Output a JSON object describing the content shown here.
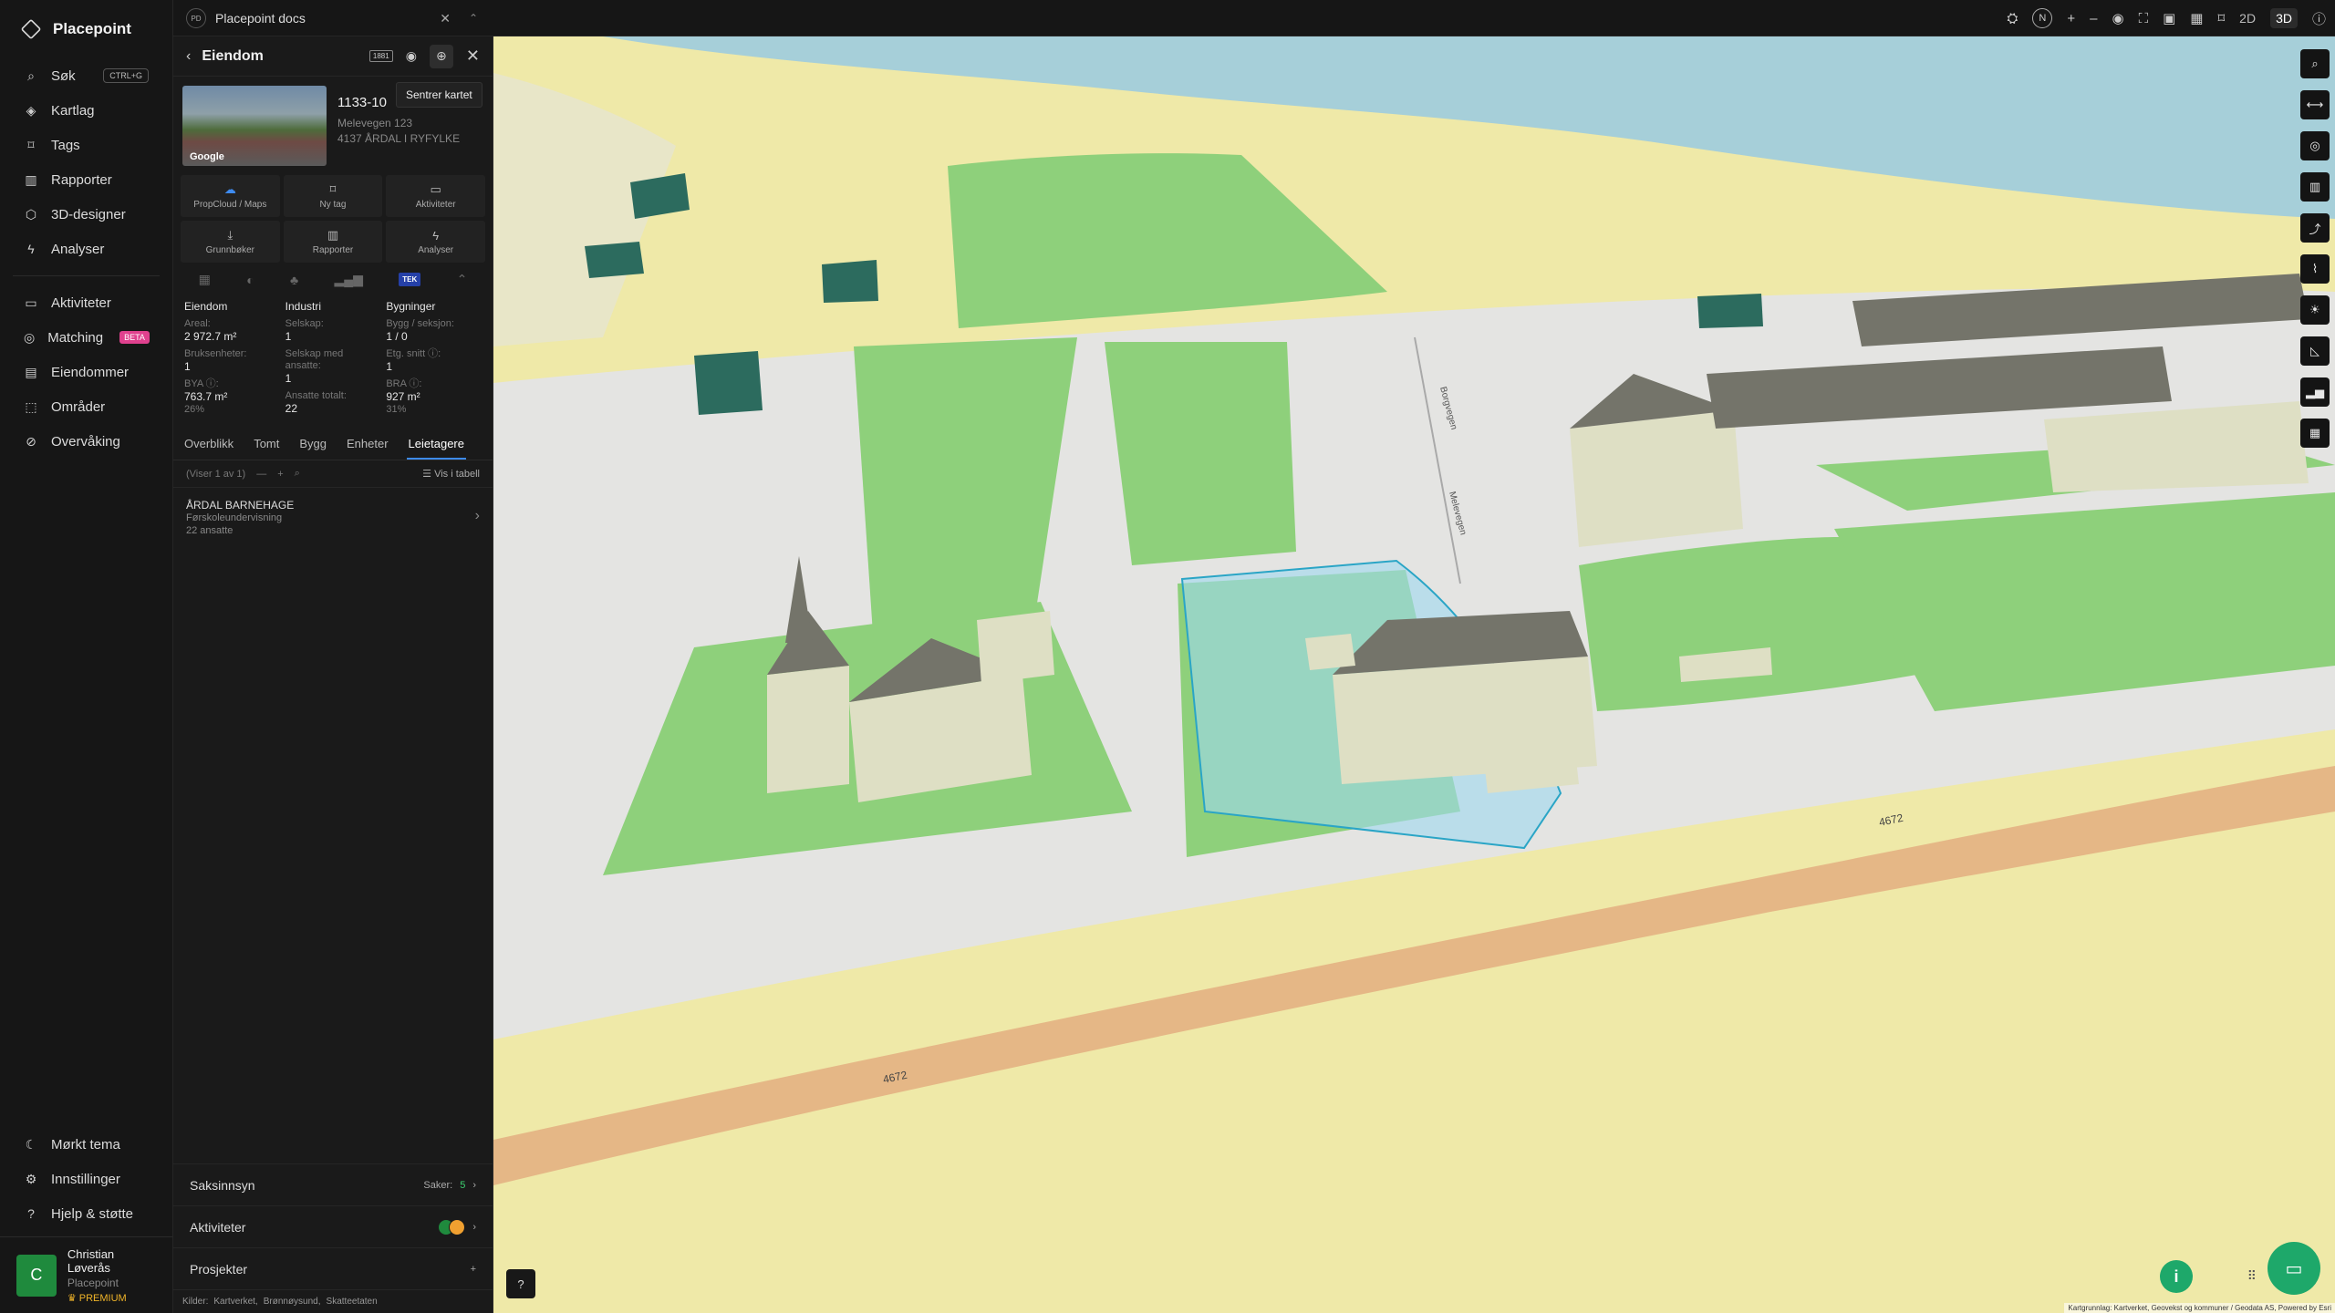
{
  "app": {
    "name": "Placepoint"
  },
  "nav": {
    "search_label": "Søk",
    "search_shortcut": "CTRL+G",
    "items": [
      {
        "label": "Kartlag"
      },
      {
        "label": "Tags"
      },
      {
        "label": "Rapporter"
      },
      {
        "label": "3D-designer"
      },
      {
        "label": "Analyser"
      }
    ],
    "items2": [
      {
        "label": "Aktiviteter"
      },
      {
        "label": "Matching",
        "badge": "BETA"
      },
      {
        "label": "Eiendommer"
      },
      {
        "label": "Områder"
      },
      {
        "label": "Overvåking"
      }
    ],
    "bottom": [
      {
        "label": "Mørkt tema"
      },
      {
        "label": "Innstillinger"
      },
      {
        "label": "Hjelp & støtte"
      }
    ]
  },
  "user": {
    "initial": "C",
    "name": "Christian Løverås",
    "org": "Placepoint",
    "tier": "PREMIUM"
  },
  "doc": {
    "badge": "PD",
    "title": "Placepoint docs"
  },
  "topbar": {
    "north": "N",
    "mode_2d": "2D",
    "mode_3d": "3D"
  },
  "panel": {
    "title": "Eiendom",
    "chip": "1881",
    "tooltip": "Sentrer kartet",
    "property_id": "1133-10",
    "address_line1": "Melevegen 123",
    "address_line2": "4137 ÅRDAL I RYFYLKE",
    "photo_tag": "Google",
    "actions": [
      {
        "label": "PropCloud / Maps"
      },
      {
        "label": "Ny tag"
      },
      {
        "label": "Aktiviteter"
      },
      {
        "label": "Grunnbøker"
      },
      {
        "label": "Rapporter"
      },
      {
        "label": "Analyser"
      }
    ],
    "tek": "TEK",
    "facts": {
      "eiendom": {
        "heading": "Eiendom",
        "areal_label": "Areal:",
        "areal_value": "2 972.7 m²",
        "bruksenheter_label": "Bruksenheter:",
        "bruksenheter_value": "1",
        "bya_label": "BYA ⓘ:",
        "bya_value": "763.7 m²",
        "bya_pct": "26%"
      },
      "industri": {
        "heading": "Industri",
        "selskap_label": "Selskap:",
        "selskap_value": "1",
        "med_ansatte_label": "Selskap med ansatte:",
        "med_ansatte_value": "1",
        "ansatte_label": "Ansatte totalt:",
        "ansatte_value": "22"
      },
      "bygninger": {
        "heading": "Bygninger",
        "bygg_label": "Bygg / seksjon:",
        "bygg_value": "1 / 0",
        "etg_label": "Etg. snitt ⓘ:",
        "etg_value": "1",
        "bra_label": "BRA ⓘ:",
        "bra_value": "927 m²",
        "bra_pct": "31%"
      }
    },
    "tabs": [
      {
        "label": "Overblikk"
      },
      {
        "label": "Tomt"
      },
      {
        "label": "Bygg"
      },
      {
        "label": "Enheter"
      },
      {
        "label": "Leietagere"
      }
    ],
    "list_count": "(Viser 1 av 1)",
    "show_table": "Vis i tabell",
    "tenant": {
      "name": "ÅRDAL BARNEHAGE",
      "type": "Førskoleundervisning",
      "employees": "22 ansatte"
    },
    "sections": {
      "saksinnsyn": {
        "label": "Saksinnsyn",
        "count_label": "Saker:",
        "count": "5"
      },
      "aktiviteter": {
        "label": "Aktiviteter"
      },
      "prosjekter": {
        "label": "Prosjekter",
        "action": "+"
      }
    },
    "sources_label": "Kilder:",
    "sources": [
      "Kartverket,",
      "Brønnøysund,",
      "Skatteetaten"
    ]
  },
  "map": {
    "road_label_1": "4672",
    "road_label_2": "4672",
    "street_1": "Melevegen",
    "street_2": "Borgvegen",
    "attribution": "Kartgrunnlag: Kartverket, Geovekst og kommuner / Geodata AS, Powered by Esri",
    "colors": {
      "fields": "#eee8a4",
      "grass": "#8ed07b",
      "paved": "#e4e4e2",
      "road": "#e5b786",
      "water": "#a6cfd9",
      "building_roof": "#74746a",
      "building_wall": "#dedfc4",
      "selected_building": "#2c6b5e",
      "selection": "#9fd8f0"
    }
  }
}
